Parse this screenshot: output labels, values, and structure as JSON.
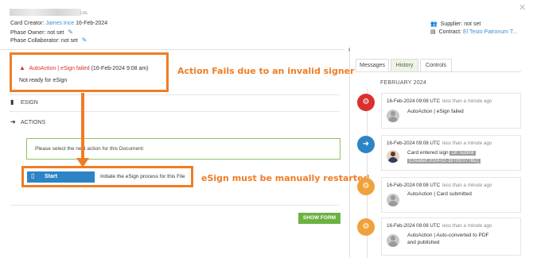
{
  "header": {
    "url_label": "URL",
    "close_symbol": "✕",
    "card_creator_label": "Card Creator:",
    "card_creator_name": "James Ince",
    "card_creator_date": "16-Feb-2024",
    "phase_owner_label": "Phase Owner:",
    "phase_owner_value": "not set",
    "phase_collaborator_label": "Phase Collaborator:",
    "phase_collaborator_value": "not set",
    "supplier_label": "Supplier:",
    "supplier_value": "not set",
    "contract_label": "Contract:",
    "contract_value": "El Testo Patronum T..."
  },
  "alert": {
    "title": "AutoAction | eSign failed",
    "date": "(16-Feb-2024 9:08 am)",
    "message": "Not ready for eSign",
    "annotation": "Action Fails due to an invalid signer"
  },
  "sections": {
    "esign_label": "ESIGN",
    "actions_label": "ACTIONS"
  },
  "next_action": {
    "prompt": "Please select the next action for this Document:",
    "start_label": "Start",
    "start_description": "Initiate the eSign process for this File",
    "annotation": "eSign must be manually restarted"
  },
  "show_form_label": "SHOW FORM",
  "right_panel": {
    "tabs": [
      {
        "label": "Messages",
        "active": false
      },
      {
        "label": "History",
        "active": true
      },
      {
        "label": "Controls",
        "active": false
      }
    ],
    "month": "FEBRUARY 2024",
    "events": [
      {
        "time": "16-Feb-2024 09:08 UTC",
        "ago": "less than a minute ago",
        "text": "AutoAction | eSign failed",
        "icon": "gears-icon",
        "color": "#d9312d"
      },
      {
        "time": "16-Feb-2024 09:08 UTC",
        "ago": "less than a minute ago",
        "text": "Card entered sign",
        "badge1": "On Submit",
        "badge2": "[Created 2024-02-16T09:07:08Z]",
        "icon": "arrow-right-icon",
        "color": "#2c84c6"
      },
      {
        "time": "16-Feb-2024 09:08 UTC",
        "ago": "less than a minute ago",
        "text": "AutoAction | Card submitted",
        "icon": "gears-icon",
        "color": "#f0a23a"
      },
      {
        "time": "16-Feb-2024 09:08 UTC",
        "ago": "less than a minute ago",
        "text": "AutoAction | Auto-converted to PDF",
        "text2": "and published",
        "icon": "gears-icon",
        "color": "#f0a23a"
      }
    ]
  },
  "colors": {
    "accent_orange": "#f07d24",
    "error_red": "#d9312d",
    "link_blue": "#3a8fd1",
    "button_blue": "#2c84c6",
    "button_green": "#6cb241"
  }
}
